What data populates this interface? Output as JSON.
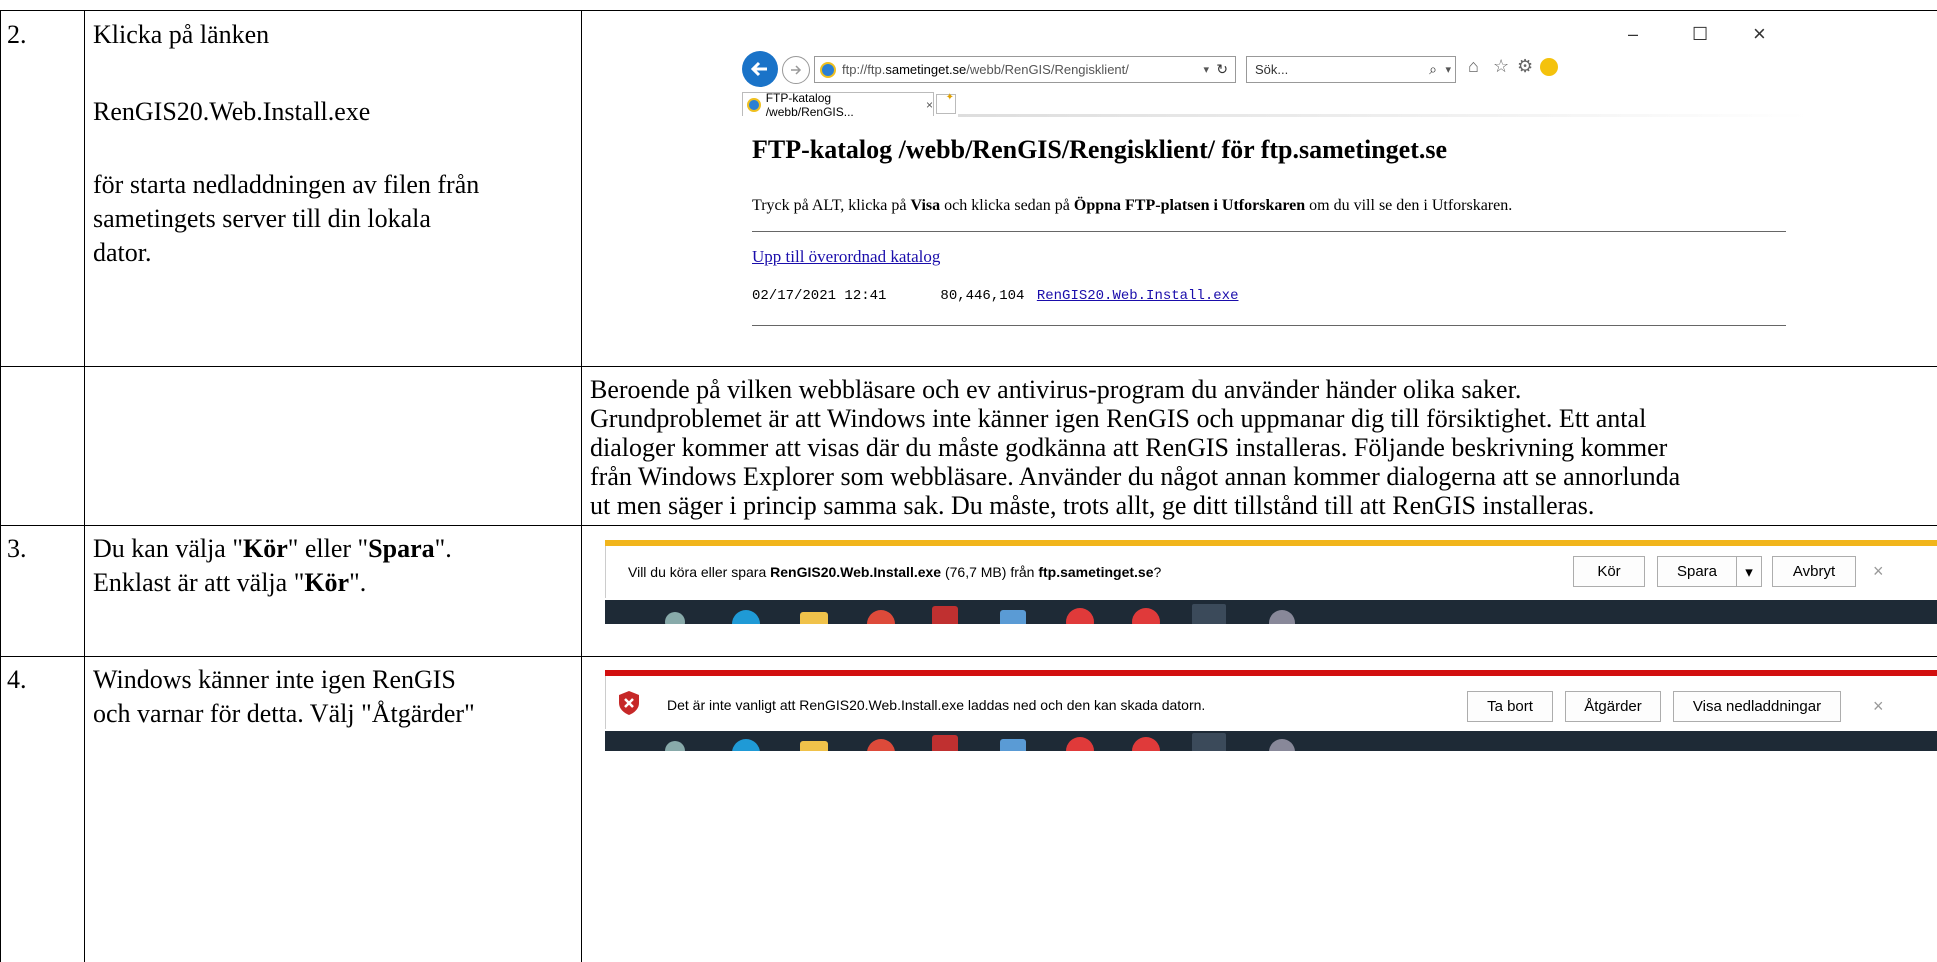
{
  "rows": [
    {
      "num": "2.",
      "instruction": {
        "line1": "Klicka på länken",
        "filename": "RenGIS20.Web.Install.exe",
        "line3a": "för starta nedladdningen av filen från",
        "line3b": "sametingets server till din lokala",
        "line3c": "dator."
      },
      "browser": {
        "address_prefix": "ftp://ftp.",
        "address_domain": "sametinget.se",
        "address_path": "/webb/RenGIS/Rengisklient/",
        "search_placeholder": "Sök...",
        "tab_title": "FTP-katalog /webb/RenGIS...",
        "tab_close": "×",
        "page_heading": "FTP-katalog /webb/RenGIS/Rengisklient/ för ftp.sametinget.se",
        "hint_a": "Tryck på ALT, klicka på ",
        "hint_b": "Visa",
        "hint_c": " och klicka sedan på ",
        "hint_d": "Öppna FTP-platsen i Utforskaren",
        "hint_e": " om du vill se den i Utforskaren.",
        "parent_link": "Upp till överordnad katalog",
        "listing_date": "02/17/2021 12:41",
        "listing_size": "80,446,104",
        "listing_link": "RenGIS20.Web.Install.exe",
        "window_min": "–",
        "window_max": "☐",
        "window_close": "×"
      }
    },
    {
      "paragraph": "Beroende på vilken webbläsare och ev antivirus-program du använder händer olika saker. Grundproblemet är att Windows inte känner igen RenGIS och uppmanar dig till försiktighet. Ett antal dialoger kommer att visas där du måste godkänna att RenGIS installeras. Följande beskrivning kommer från Windows Explorer som webbläsare. Använder du något annan kommer dialogerna att se annorlunda ut men säger i princip samma sak. Du måste, trots allt, ge ditt tillstånd till att RenGIS installeras.",
      "lines": [
        "Beroende på vilken webbläsare och ev antivirus-program du använder händer olika saker.",
        "Grundproblemet är att Windows inte känner igen RenGIS och uppmanar dig till försiktighet. Ett antal",
        "dialoger kommer att visas där du måste godkänna att RenGIS installeras. Följande beskrivning kommer",
        "från Windows Explorer som webbläsare. Använder du något annan kommer dialogerna att se annorlunda",
        "ut men säger i princip samma sak. Du måste, trots allt, ge ditt tillstånd till att RenGIS installeras."
      ]
    },
    {
      "num": "3.",
      "instruction": {
        "l1a": "Du kan välja \"",
        "l1b": "Kör",
        "l1c": "\" eller \"",
        "l1d": "Spara",
        "l1e": "\".",
        "l2a": "Enklast är att välja \"",
        "l2b": "Kör",
        "l2c": "\"."
      },
      "bar": {
        "msg_a": "Vill du köra eller spara ",
        "msg_b": "RenGIS20.Web.Install.exe",
        "msg_c": " (76,7 MB) från ",
        "msg_d": "ftp.sametinget.se",
        "msg_e": "?",
        "run": "Kör",
        "save": "Spara",
        "save_arrow": "▾",
        "cancel": "Avbryt",
        "close": "×",
        "accent": "#f1b51c"
      }
    },
    {
      "num": "4.",
      "instruction": {
        "line1": "Windows känner inte igen RenGIS",
        "line2": "och varnar för detta. Välj \"Åtgärder\""
      },
      "bar": {
        "msg": "Det är inte vanligt att RenGIS20.Web.Install.exe laddas ned och den kan skada datorn.",
        "delete": "Ta bort",
        "actions": "Åtgärder",
        "show": "Visa nedladdningar",
        "close": "×",
        "accent": "#d20f0f"
      }
    }
  ]
}
